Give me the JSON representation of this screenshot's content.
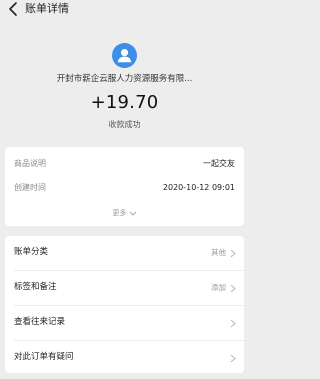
{
  "header": {
    "title": "账单详情"
  },
  "merchant": {
    "name": "开封市薪企云服人力资源服务有限...",
    "amount": "+19.70",
    "status": "收款成功"
  },
  "details": {
    "rows": [
      {
        "label": "商品说明",
        "value": "一起交友"
      },
      {
        "label": "创建时间",
        "value": "2020-10-12 09:01"
      }
    ],
    "more_label": "更多"
  },
  "menu": {
    "items": [
      {
        "label": "账单分类",
        "value": "其他"
      },
      {
        "label": "标签和备注",
        "value": "添加"
      },
      {
        "label": "查看往来记录",
        "value": ""
      },
      {
        "label": "对此订单有疑问",
        "value": ""
      }
    ]
  },
  "colors": {
    "accent": "#3d8fe6",
    "background": "#ededed"
  }
}
